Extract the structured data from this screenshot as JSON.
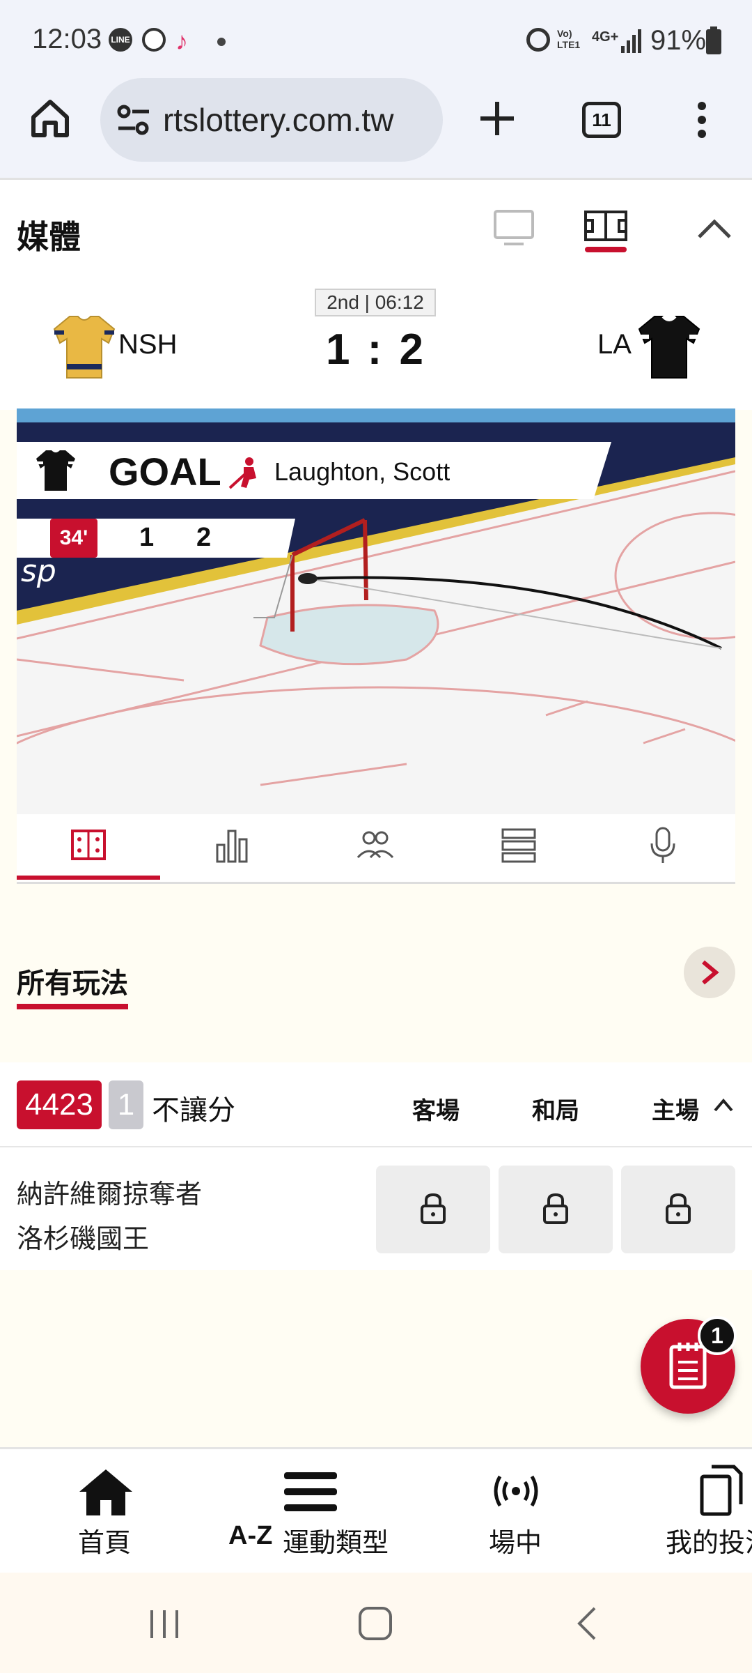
{
  "status_bar": {
    "time": "12:03",
    "battery": "91%",
    "network_label": "4G+",
    "icons": [
      "line-icon",
      "soccer-icon",
      "tiktok-icon",
      "dot-icon",
      "alarm-icon",
      "volte-icon",
      "signal-icon",
      "battery-icon"
    ]
  },
  "browser": {
    "url": "rtslottery.com.tw",
    "tab_count": "11"
  },
  "media": {
    "title": "媒體"
  },
  "match": {
    "period": "2nd | 06:12",
    "home_abbr": "NSH",
    "away_abbr": "LA",
    "score": "1 : 2",
    "colors": {
      "home_jersey": "#e9b844",
      "away_jersey": "#111111"
    }
  },
  "tracker": {
    "event": "GOAL",
    "player": "Laughton, Scott",
    "minute": "34'",
    "home_score": "1",
    "away_score": "2",
    "board_text": "sp"
  },
  "tracker_tabs": [
    "field-icon",
    "stats-icon",
    "lineups-icon",
    "timeline-icon",
    "commentary-icon"
  ],
  "all_bets": {
    "title": "所有玩法"
  },
  "market": {
    "code": "4423",
    "number": "1",
    "name": "不讓分",
    "columns": {
      "away": "客場",
      "draw": "和局",
      "home": "主場"
    },
    "teams": [
      "納許維爾掠奪者",
      "洛杉磯國王"
    ]
  },
  "betslip": {
    "count": "1"
  },
  "bottom_nav": {
    "home": "首頁",
    "az_prefix": "A-Z",
    "sports": "運動類型",
    "live": "場中",
    "my_bets": "我的投注"
  },
  "theme": {
    "accent": "#c8102e"
  }
}
